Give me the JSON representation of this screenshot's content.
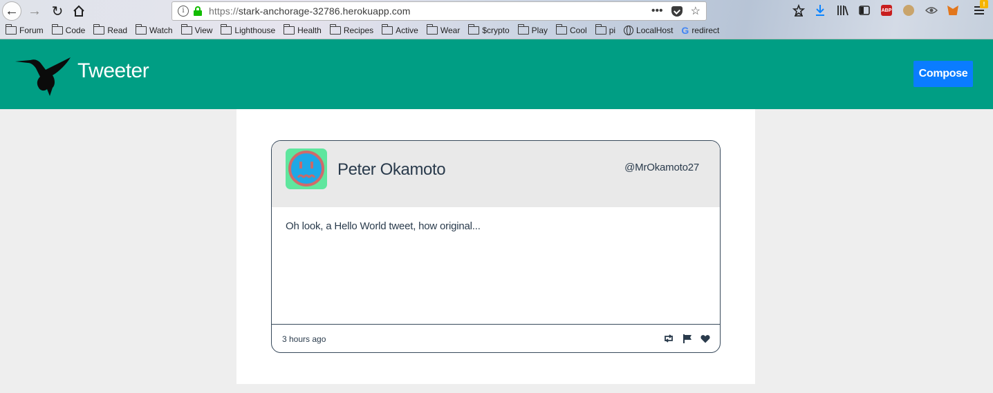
{
  "browser": {
    "url_scheme": "https://",
    "url_host": "stark-anchorage-32786.herokuapp.com",
    "page_actions_label": "•••",
    "badge": "!",
    "bookmarks": [
      {
        "label": "Forum",
        "icon": "folder-icon"
      },
      {
        "label": "Code",
        "icon": "folder-icon"
      },
      {
        "label": "Read",
        "icon": "folder-icon"
      },
      {
        "label": "Watch",
        "icon": "folder-icon"
      },
      {
        "label": "View",
        "icon": "folder-icon"
      },
      {
        "label": "Lighthouse",
        "icon": "folder-icon"
      },
      {
        "label": "Health",
        "icon": "folder-icon"
      },
      {
        "label": "Recipes",
        "icon": "folder-icon"
      },
      {
        "label": "Active",
        "icon": "folder-icon"
      },
      {
        "label": "Wear",
        "icon": "folder-icon"
      },
      {
        "label": "$crypto",
        "icon": "folder-icon"
      },
      {
        "label": "Play",
        "icon": "folder-icon"
      },
      {
        "label": "Cool",
        "icon": "folder-icon"
      },
      {
        "label": "pi",
        "icon": "folder-icon"
      },
      {
        "label": "LocalHost",
        "icon": "globe-icon"
      },
      {
        "label": "redirect",
        "icon": "google-icon"
      }
    ]
  },
  "header": {
    "title": "Tweeter",
    "compose_label": "Compose",
    "accent": "#009e84",
    "button_color": "#0a7cff"
  },
  "tweet": {
    "name": "Peter Okamoto",
    "handle": "@MrOkamoto27",
    "content": "Oh look, a Hello World tweet, how original...",
    "time": "3 hours ago",
    "actions": [
      "retweet-icon",
      "flag-icon",
      "heart-icon"
    ]
  }
}
